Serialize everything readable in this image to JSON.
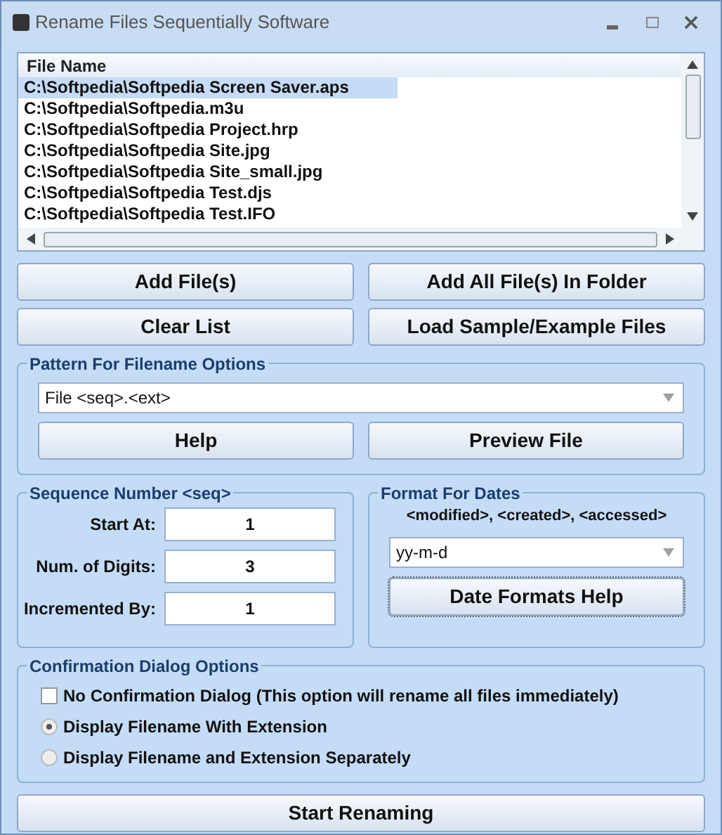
{
  "window": {
    "title": "Rename Files Sequentially Software"
  },
  "file_list": {
    "header": "File Name",
    "rows": [
      {
        "path": "C:\\Softpedia\\Softpedia Screen Saver.aps",
        "selected": true
      },
      {
        "path": "C:\\Softpedia\\Softpedia.m3u",
        "selected": false
      },
      {
        "path": "C:\\Softpedia\\Softpedia Project.hrp",
        "selected": false
      },
      {
        "path": "C:\\Softpedia\\Softpedia Site.jpg",
        "selected": false
      },
      {
        "path": "C:\\Softpedia\\Softpedia Site_small.jpg",
        "selected": false
      },
      {
        "path": "C:\\Softpedia\\Softpedia Test.djs",
        "selected": false
      },
      {
        "path": "C:\\Softpedia\\Softpedia Test.IFO",
        "selected": false
      }
    ]
  },
  "buttons": [
    "Add File(s)",
    "Add All File(s) In Folder",
    "Clear List",
    "Load Sample/Example Files"
  ],
  "pattern": {
    "title": "Pattern For Filename Options",
    "value": "File <seq>.<ext>",
    "buttons": [
      "Help",
      "Preview File"
    ]
  },
  "sequence": {
    "title": "Sequence Number <seq>",
    "fields": [
      {
        "label": "Start At:",
        "value": "1"
      },
      {
        "label": "Num. of Digits:",
        "value": "3"
      },
      {
        "label": "Incremented By:",
        "value": "1"
      }
    ]
  },
  "dates": {
    "title": "Format For Dates",
    "hint": "<modified>, <created>, <accessed>",
    "value": "yy-m-d",
    "button": "Date Formats Help"
  },
  "confirmation": {
    "title": "Confirmation Dialog Options",
    "options": [
      {
        "kind": "checkbox",
        "label": "No Confirmation Dialog (This option will rename all files immediately)",
        "checked": false
      },
      {
        "kind": "radio",
        "label": "Display Filename With Extension",
        "selected": true
      },
      {
        "kind": "radio",
        "label": "Display Filename and Extension Separately",
        "selected": false
      }
    ]
  },
  "start_button": "Start Renaming"
}
